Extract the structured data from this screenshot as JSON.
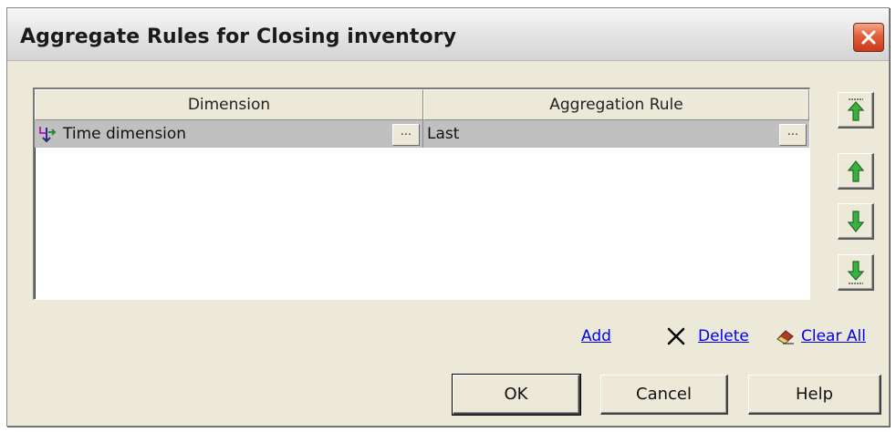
{
  "dialog": {
    "title": "Aggregate Rules for Closing inventory"
  },
  "grid": {
    "columns": [
      "Dimension",
      "Aggregation Rule"
    ],
    "rows": [
      {
        "dimension": "Time dimension",
        "rule": "Last",
        "ellipsis": "..."
      }
    ]
  },
  "side_buttons": [
    "move-top",
    "move-up",
    "move-down",
    "move-bottom"
  ],
  "actions": {
    "add_label": "Add",
    "delete_label": "Delete",
    "clear_all_label": "Clear All"
  },
  "buttons": {
    "ok_label": "OK",
    "cancel_label": "Cancel",
    "help_label": "Help"
  },
  "colors": {
    "arrow_green": "#3cb043",
    "link_blue": "#0000ee",
    "row_selected": "#c0c0c0"
  }
}
